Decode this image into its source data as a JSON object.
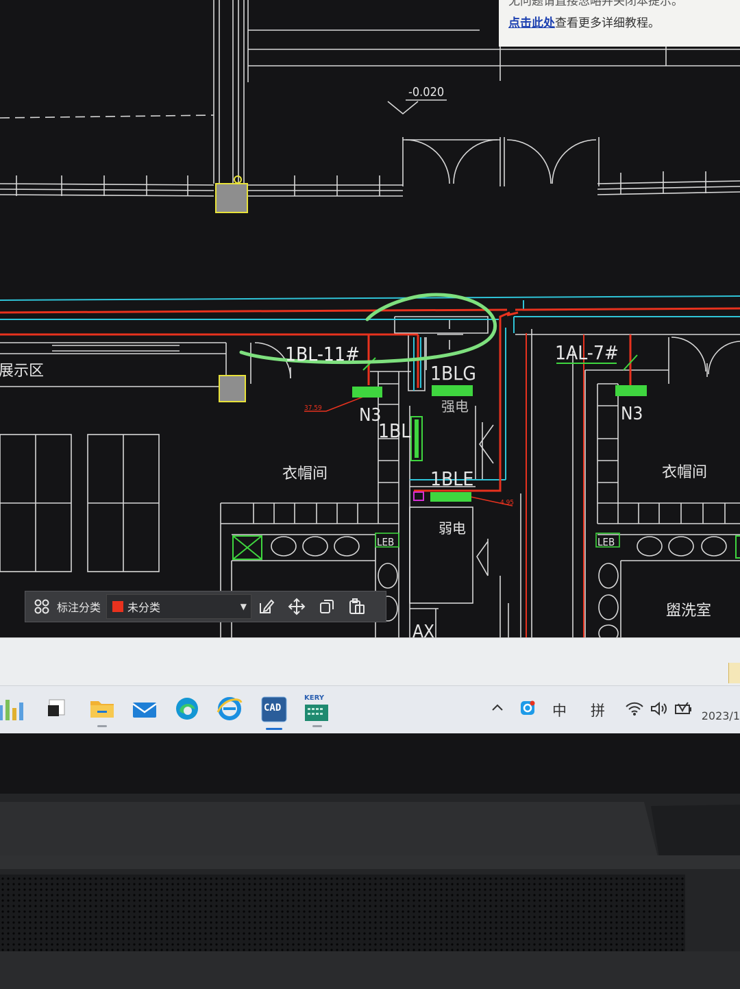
{
  "tip": {
    "line1": "无问题请直接忽略并关闭本提示。",
    "link": "点击此处",
    "line2_rest": "查看更多详细教程。"
  },
  "drawing": {
    "elevation": "-0.020",
    "labels": {
      "panel_1": "1BL-11#",
      "panel_2": "1BLG",
      "panel_3": "1BL",
      "panel_4": "1BLE",
      "panel_5": "1AL-7#",
      "n3_left": "N3",
      "n3_right": "N3",
      "ax": "AX",
      "leb_left": "LEB",
      "leb_right": "LEB",
      "room_exhibition": "展示区",
      "room_cloak_left": "衣帽间",
      "room_cloak_right": "衣帽间",
      "room_strong": "强电",
      "room_weak": "弱电",
      "room_wash": "盥洗室",
      "dim_left": "37.59",
      "dim_right": "4.95"
    },
    "colors": {
      "background": "#141416",
      "wall": "#d8d8d8",
      "cyan": "#2fc4d8",
      "red": "#e8321e",
      "green": "#3fd63f",
      "highlight": "#7ee07e",
      "yellow": "#e8e23a"
    }
  },
  "annotation_toolbar": {
    "menu_icon": "grid-icon",
    "label": "标注分类",
    "category": "未分类",
    "category_color": "#e8321e",
    "tools": [
      "edit-icon",
      "move-icon",
      "copy-icon",
      "paste-icon"
    ]
  },
  "taskbar": {
    "apps": [
      "chart-app-icon",
      "app-icon",
      "file-explorer-icon",
      "mail-icon",
      "edge-icon",
      "ie-icon",
      "cad-icon",
      "kery-icon"
    ],
    "cad_label": "CAD",
    "kery_label": "KERY",
    "tray": {
      "ime_mode": "中",
      "ime_input": "拼",
      "date": "2023/1"
    }
  }
}
